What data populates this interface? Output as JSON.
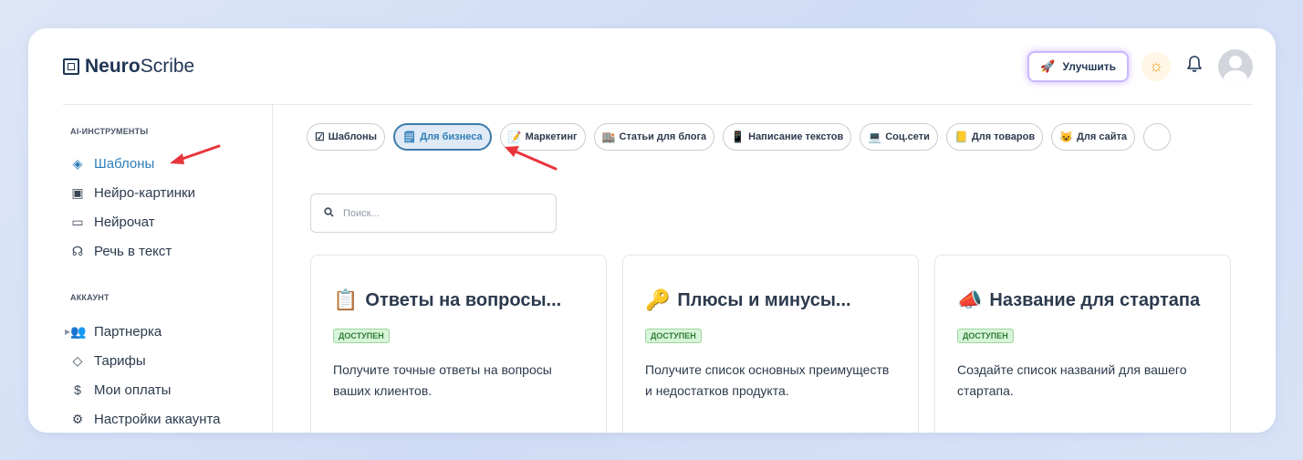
{
  "app": {
    "logo_bold": "Neuro",
    "logo_rest": "Scribe"
  },
  "header": {
    "upgrade_label": "Улучшить"
  },
  "sidebar": {
    "section_tools": "AI-ИНСТРУМЕНТЫ",
    "tools": [
      {
        "label": "Шаблоны",
        "icon": "layers-icon"
      },
      {
        "label": "Нейро-картинки",
        "icon": "image-icon"
      },
      {
        "label": "Нейрочат",
        "icon": "chat-icon"
      },
      {
        "label": "Речь в текст",
        "icon": "headphones-icon"
      }
    ],
    "section_account": "АККАУНТ",
    "account": [
      {
        "label": "Партнерка",
        "icon": "users-icon"
      },
      {
        "label": "Тарифы",
        "icon": "tag-icon"
      },
      {
        "label": "Мои оплаты",
        "icon": "dollar-icon"
      },
      {
        "label": "Настройки аккаунта",
        "icon": "settings-icon"
      }
    ]
  },
  "tabs": [
    {
      "emoji": "☑",
      "label": "Шаблоны"
    },
    {
      "emoji": "🗒",
      "label": "Для бизнеса"
    },
    {
      "emoji": "📝",
      "label": "Маркетинг"
    },
    {
      "emoji": "🏬",
      "label": "Статьи для блога"
    },
    {
      "emoji": "📱",
      "label": "Написание текстов"
    },
    {
      "emoji": "💻",
      "label": "Соц.сети"
    },
    {
      "emoji": "📒",
      "label": "Для товаров"
    },
    {
      "emoji": "😺",
      "label": "Для сайта"
    }
  ],
  "search": {
    "placeholder": "Поиск..."
  },
  "cards": [
    {
      "emoji": "📋",
      "title": "Ответы на вопросы...",
      "badge": "ДОСТУПЕН",
      "desc": "Получите точные ответы на вопросы ваших клиентов."
    },
    {
      "emoji": "🔑",
      "title": "Плюсы и минусы...",
      "badge": "ДОСТУПЕН",
      "desc": "Получите список основных преимуществ и недостатков продукта."
    },
    {
      "emoji": "📣",
      "title": "Название для стартапа",
      "badge": "ДОСТУПЕН",
      "desc": "Создайте список названий для вашего стартапа."
    }
  ]
}
